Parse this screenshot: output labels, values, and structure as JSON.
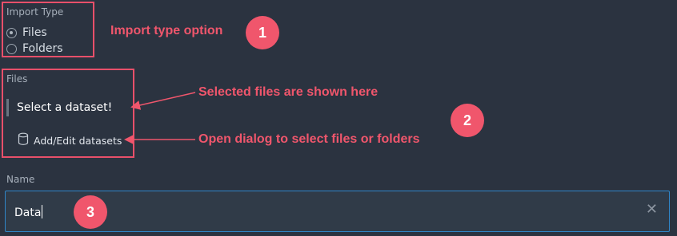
{
  "import_type": {
    "label": "Import Type",
    "options": [
      {
        "label": "Files",
        "selected": true
      },
      {
        "label": "Folders",
        "selected": false
      }
    ]
  },
  "files": {
    "label": "Files",
    "placeholder": "Select a dataset!",
    "add_edit_label": "Add/Edit datasets",
    "add_edit_icon": "database-icon"
  },
  "name": {
    "label": "Name",
    "value": "Data",
    "clear_icon": "close-icon"
  },
  "annotations": {
    "import_type_option": "Import type option",
    "selected_files": "Selected files are shown here",
    "open_dialog": "Open dialog to select files or folders",
    "badges": [
      "1",
      "2",
      "3"
    ]
  },
  "colors": {
    "background": "#2b3340",
    "annotation": "#f0566c",
    "input_border": "#2f86c8"
  }
}
